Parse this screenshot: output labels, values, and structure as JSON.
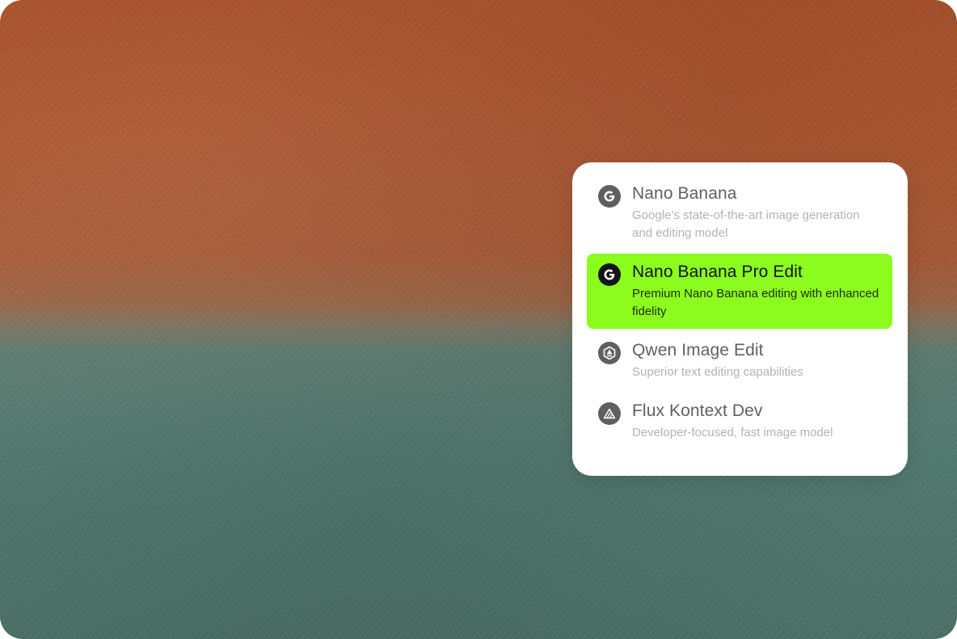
{
  "model_menu": {
    "items": [
      {
        "title": "Nano Banana",
        "description": "Google’s state-of-the-art image generation and editing model",
        "icon": "google-icon",
        "selected": false
      },
      {
        "title": "Nano Banana Pro Edit",
        "description": "Premium Nano Banana editing with enhanced fidelity",
        "icon": "google-icon",
        "selected": true
      },
      {
        "title": "Qwen Image Edit",
        "description": "Superior text editing capabilities",
        "icon": "qwen-icon",
        "selected": false
      },
      {
        "title": "Flux Kontext Dev",
        "description": "Developer-focused, fast image model",
        "icon": "flux-icon",
        "selected": false
      }
    ]
  },
  "colors": {
    "selected_background": "#8cfc1e",
    "title_text": "#5f5f66",
    "description_text": "#b3b3b8",
    "background_top": "#a9502a",
    "background_bottom": "#4b7066"
  }
}
